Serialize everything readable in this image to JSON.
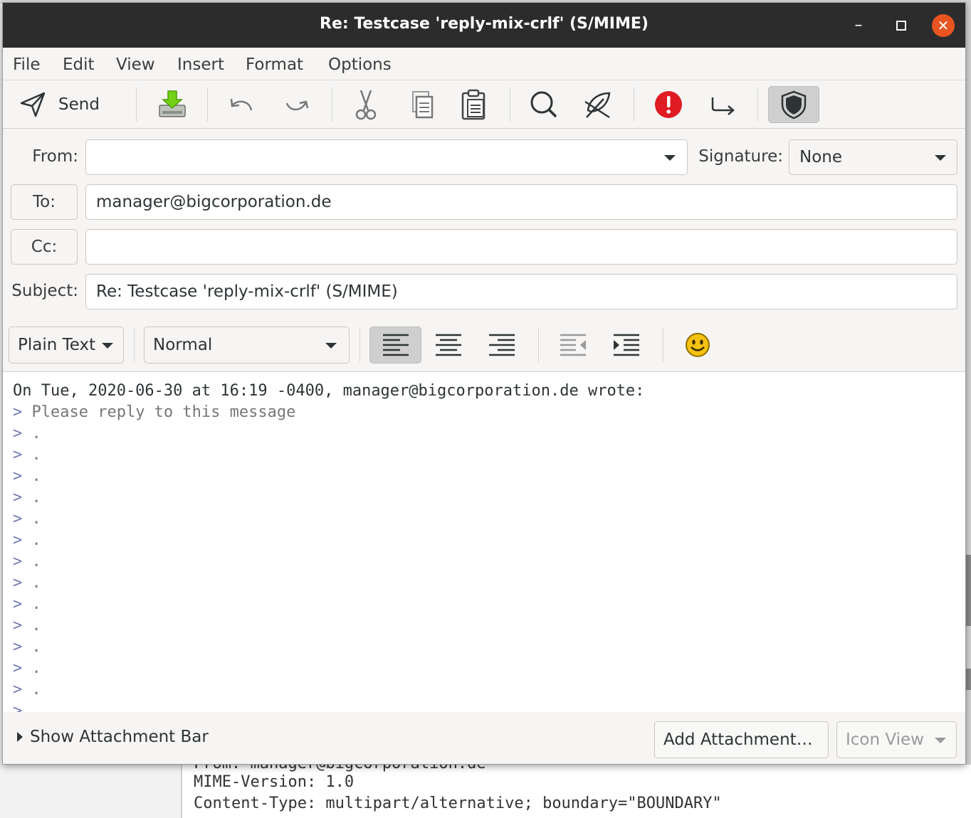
{
  "window": {
    "title": "Re: Testcase 'reply-mix-crlf' (S/MIME)",
    "minimize_glyph": "–",
    "maximize_glyph": "☐",
    "close_glyph": "✕"
  },
  "menu": [
    "File",
    "Edit",
    "View",
    "Insert",
    "Format",
    "Options"
  ],
  "toolbar": {
    "send_label": "Send",
    "icons": [
      "send-icon",
      "save-icon",
      "undo-icon",
      "redo-icon",
      "cut-icon",
      "copy-icon",
      "paste-icon",
      "find-icon",
      "spellcheck-icon",
      "priority-icon",
      "return-receipt-icon",
      "security-shield-icon"
    ],
    "priority_color": "#e01b24"
  },
  "headers": {
    "from_label": "From:",
    "from_value": "",
    "signature_label": "Signature:",
    "signature_value": "None",
    "to_label": "To:",
    "to_value": "manager@bigcorporation.de",
    "cc_label": "Cc:",
    "cc_value": "",
    "subject_label": "Subject:",
    "subject_value": "Re: Testcase 'reply-mix-crlf' (S/MIME)"
  },
  "format_bar": {
    "mode": "Plain Text",
    "paragraph_style": "Normal",
    "icons": [
      "align-left-icon",
      "align-center-icon",
      "align-right-icon",
      "unindent-icon",
      "indent-icon",
      "emoticon-icon"
    ]
  },
  "body": {
    "attribution": "On Tue, 2020-06-30 at 16:19 -0400, manager@bigcorporation.de wrote:",
    "quote_marker": ">",
    "first_quote": "Please reply to this message",
    "dot_lines": [
      ".",
      ".",
      ".",
      ".",
      ".",
      ".",
      ".",
      ".",
      ".",
      ".",
      ".",
      ".",
      ".",
      "."
    ]
  },
  "attachment_bar": {
    "toggle_label": "Show Attachment Bar",
    "add_label": "Add Attachment…",
    "view_label": "Icon View"
  },
  "background_terminal": {
    "line1": "From: manager@bigcorporation.de",
    "line2": "MIME-Version: 1.0",
    "line3": "Content-Type: multipart/alternative; boundary=\"BOUNDARY\""
  }
}
